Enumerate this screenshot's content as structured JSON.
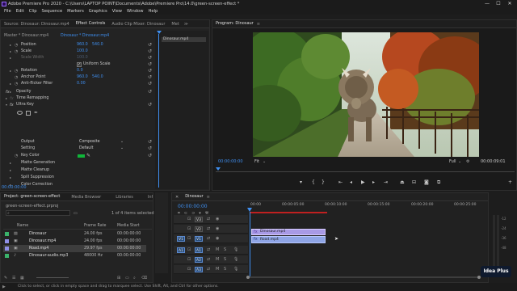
{
  "window": {
    "title": "Adobe Premiere Pro 2020 - C:\\Users\\LAPTOP POINT\\Documents\\Adobe\\Premiere Pro\\14.0\\green-screen-effect *",
    "minimize": "—",
    "maximize": "☐",
    "close": "✕"
  },
  "menu": [
    "File",
    "Edit",
    "Clip",
    "Sequence",
    "Markers",
    "Graphics",
    "View",
    "Window",
    "Help"
  ],
  "source_panel": {
    "tabs": [
      "Source: Dinosaur: Dinosaur.mp4",
      "Effect Controls",
      "Audio Clip Mixer: Dinosaur",
      "Met"
    ],
    "master": "Master * Dinosaur.mp4",
    "clip": "Dinosaur * Dinosaur.mp4",
    "clip_label": "Dinosaur.mp4",
    "timecode": "00:00:00:00",
    "rows": [
      {
        "name": "Position",
        "v1": "960.0",
        "v2": "540.0"
      },
      {
        "name": "Scale",
        "v1": "100.0",
        "v2": ""
      },
      {
        "name": "Scale Width",
        "v1": "100.0",
        "v2": ""
      },
      {
        "name": "Uniform Scale",
        "v1": "",
        "v2": ""
      },
      {
        "name": "Rotation",
        "v1": "0.0",
        "v2": ""
      },
      {
        "name": "Anchor Point",
        "v1": "960.0",
        "v2": "540.0"
      },
      {
        "name": "Anti-flicker Filter",
        "v1": "0.00",
        "v2": ""
      },
      {
        "name": "Opacity",
        "v1": "",
        "v2": ""
      },
      {
        "name": "Time Remapping",
        "v1": "",
        "v2": ""
      },
      {
        "name": "Ultra Key",
        "v1": "",
        "v2": ""
      },
      {
        "name": "Output",
        "v1": "Composite",
        "v2": ""
      },
      {
        "name": "Setting",
        "v1": "Default",
        "v2": ""
      },
      {
        "name": "Key Color",
        "v1": "",
        "v2": ""
      },
      {
        "name": "Matte Generation",
        "v1": "",
        "v2": ""
      },
      {
        "name": "Matte Cleanup",
        "v1": "",
        "v2": ""
      },
      {
        "name": "Spill Suppression",
        "v1": "",
        "v2": ""
      },
      {
        "name": "Color Correction",
        "v1": "",
        "v2": ""
      }
    ]
  },
  "program": {
    "tab": "Program: Dinosaur",
    "timecode_left": "00:00:00:00",
    "fit": "Fit",
    "full": "Full",
    "timecode_right": "00:00:09:01"
  },
  "project": {
    "tabs": [
      "Project: green-screen-effect",
      "Media Browser",
      "Libraries",
      "Info"
    ],
    "file": "green-screen-effect.prproj",
    "search_placeholder": "",
    "selected_count": "1 of 4 items selected",
    "columns": [
      "Name",
      "Frame Rate",
      "Media Start"
    ],
    "items": [
      {
        "name": "Dinosaur",
        "rate": "24.00 fps",
        "start": "00:00:00:00",
        "color": "#3ab26b",
        "icon": "sequence-icon"
      },
      {
        "name": "Dinosaur.mp4",
        "rate": "24.00 fps",
        "start": "00:00:00:00",
        "color": "#8f8fe8",
        "icon": "video-file-icon"
      },
      {
        "name": "Road.mp4",
        "rate": "29.97 fps",
        "start": "00:00:00:00",
        "color": "#8f8fe8",
        "icon": "video-file-icon"
      },
      {
        "name": "Dinosaur-audio.mp3",
        "rate": "48000 Hz",
        "start": "00:00:00:00",
        "color": "#3ab26b",
        "icon": "audio-file-icon"
      }
    ]
  },
  "timeline": {
    "tab": "Dinosaur",
    "timecode": "00:00:00:00",
    "ruler": [
      "00:00",
      "00:00:05:00",
      "00:00:10:00",
      "00:00:15:00",
      "00:00:20:00",
      "00:00:25:00"
    ],
    "tracks": [
      "V3",
      "V2",
      "V1",
      "A1",
      "A2",
      "A3"
    ],
    "src_tags": [
      "V1",
      "A1"
    ],
    "clips": [
      {
        "label": "Dinosaur.mp4",
        "track": "V2",
        "color": "#a89ae6"
      },
      {
        "label": "Road.mp4",
        "track": "V1",
        "color": "#8fa5e6"
      }
    ]
  },
  "meters": [
    "-12",
    "-24",
    "-36",
    "-48",
    "dB"
  ],
  "status": "Click to select, or click in empty space and drag to marquee select. Use Shift, Alt, and Ctrl for other options.",
  "watermark": "Idea Plus"
}
